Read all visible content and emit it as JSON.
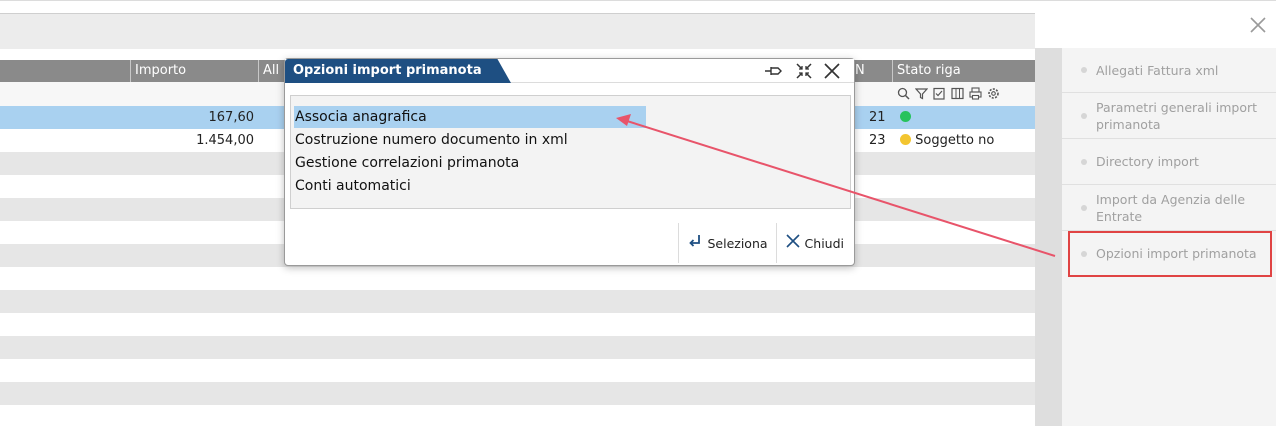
{
  "window": {
    "close_icon": "close-icon"
  },
  "grid": {
    "columns": [
      "Importo",
      "All",
      "N",
      "Stato riga"
    ],
    "rows": [
      {
        "importo": "167,60",
        "n": "21",
        "stato": "",
        "dot_color": "#27c25d"
      },
      {
        "importo": "1.454,00",
        "n": "23",
        "stato": "Soggetto no",
        "dot_color": "#f3c530"
      }
    ],
    "tool_icons": [
      "search-icon",
      "filter-icon",
      "checklist-icon",
      "columns-icon",
      "print-icon",
      "settings-icon"
    ]
  },
  "sidebar": {
    "items": [
      {
        "label": "Allegati Fattura xml"
      },
      {
        "label": "Parametri generali import primanota"
      },
      {
        "label": "Directory import"
      },
      {
        "label": "Import da Agenzia delle Entrate"
      },
      {
        "label": "Opzioni import primanota"
      }
    ]
  },
  "dialog": {
    "title": "Opzioni import primanota",
    "items": [
      "Associa anagrafica",
      "Costruzione numero documento in xml",
      "Gestione correlazioni primanota",
      "Conti automatici"
    ],
    "selected_index": 0,
    "buttons": {
      "select": "Seleziona",
      "close": "Chiudi"
    }
  },
  "colors": {
    "accent": "#1e4f82",
    "selection": "#a9d1f0",
    "highlight": "#e04343",
    "arrow": "#e8546a"
  }
}
